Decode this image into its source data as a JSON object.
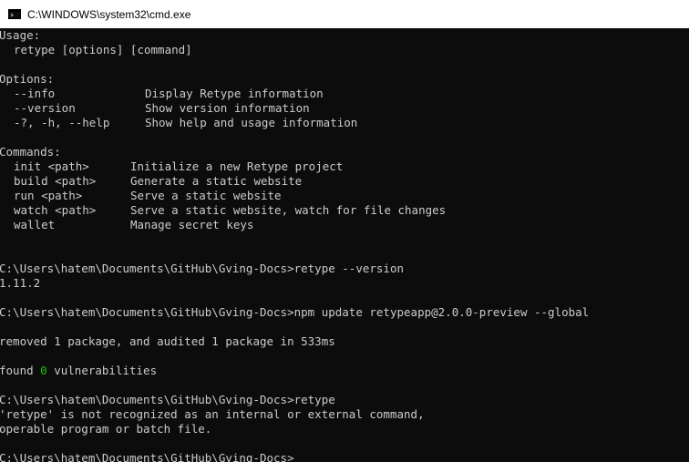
{
  "window": {
    "title": "C:\\WINDOWS\\system32\\cmd.exe",
    "icon": "cmd-icon"
  },
  "console": {
    "usage_header": "Usage:",
    "usage_line": "retype [options] [command]",
    "options_header": "Options:",
    "options": [
      {
        "flag": "--info",
        "desc": "Display Retype information"
      },
      {
        "flag": "--version",
        "desc": "Show version information"
      },
      {
        "flag": "-?, -h, --help",
        "desc": "Show help and usage information"
      }
    ],
    "commands_header": "Commands:",
    "commands": [
      {
        "name": "init <path>",
        "desc": "Initialize a new Retype project"
      },
      {
        "name": "build <path>",
        "desc": "Generate a static website"
      },
      {
        "name": "run <path>",
        "desc": "Serve a static website"
      },
      {
        "name": "watch <path>",
        "desc": "Serve a static website, watch for file changes"
      },
      {
        "name": "wallet",
        "desc": "Manage secret keys"
      }
    ],
    "prompt1": "C:\\Users\\hatem\\Documents\\GitHub\\Gving-Docs>retype --version",
    "version_output": "1.11.2",
    "prompt2": "C:\\Users\\hatem\\Documents\\GitHub\\Gving-Docs>npm update retypeapp@2.0.0-preview --global",
    "npm_removed": "removed 1 package, and audited 1 package in 533ms",
    "found_prefix": "found ",
    "found_count": "0",
    "found_suffix": " vulnerabilities",
    "prompt3": "C:\\Users\\hatem\\Documents\\GitHub\\Gving-Docs>retype",
    "error_line1": "'retype' is not recognized as an internal or external command,",
    "error_line2": "operable program or batch file.",
    "prompt4": "C:\\Users\\hatem\\Documents\\GitHub\\Gving-Docs>"
  },
  "colors": {
    "background": "#0c0c0c",
    "text": "#cccccc",
    "success": "#16c60c",
    "titlebar": "#ffffff"
  }
}
